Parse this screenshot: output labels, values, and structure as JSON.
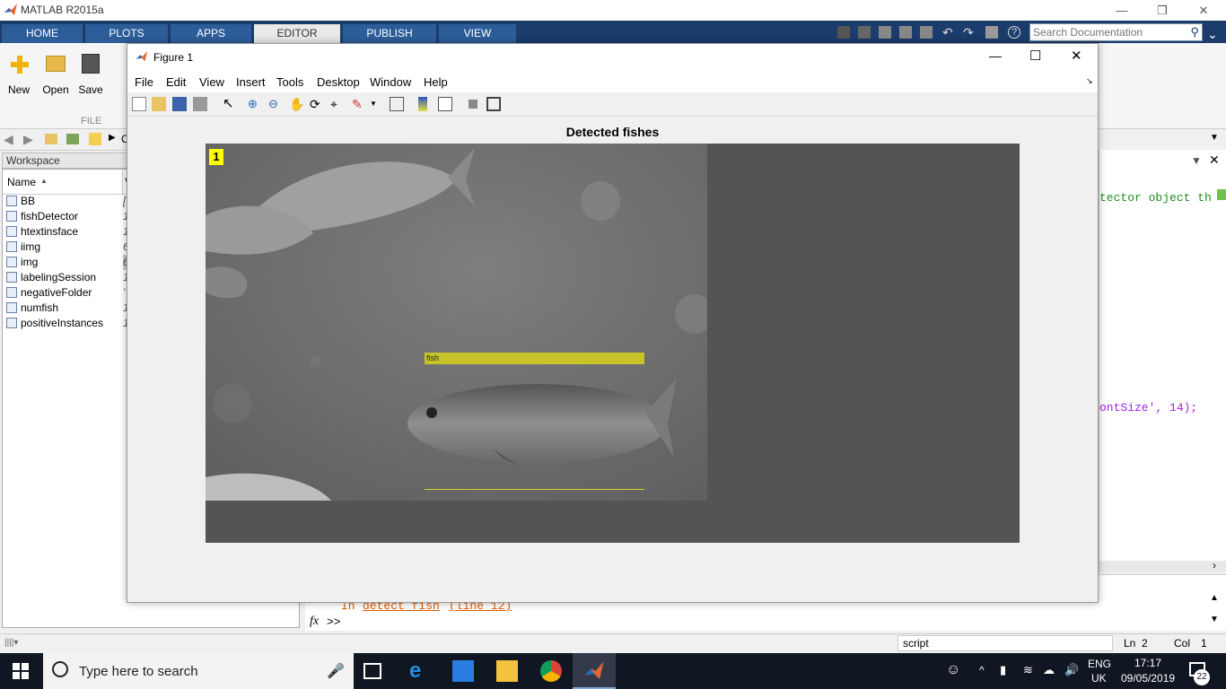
{
  "app": {
    "title": "MATLAB R2015a"
  },
  "ribbon": {
    "tabs": [
      "HOME",
      "PLOTS",
      "APPS",
      "EDITOR",
      "PUBLISH",
      "VIEW"
    ],
    "active_tab": "EDITOR",
    "search_placeholder": "Search Documentation",
    "file_buttons": {
      "new": "New",
      "open": "Open",
      "save": "Save"
    },
    "section_file": "FILE"
  },
  "address": {
    "partial": "C"
  },
  "workspace": {
    "title": "Workspace",
    "col_name": "Name",
    "col_value": "V",
    "rows": [
      {
        "name": "BB",
        "value": "["
      },
      {
        "name": "fishDetector",
        "value": "1"
      },
      {
        "name": "htextinsface",
        "value": "1"
      },
      {
        "name": "iimg",
        "value": "6"
      },
      {
        "name": "img",
        "value": "6"
      },
      {
        "name": "labelingSession",
        "value": "1"
      },
      {
        "name": "negativeFolder",
        "value": "'"
      },
      {
        "name": "numfish",
        "value": "1"
      },
      {
        "name": "positiveInstances",
        "value": "1"
      }
    ]
  },
  "editor": {
    "code_line1": "tector object th",
    "code_line2": "ontSize', 14);"
  },
  "command": {
    "error_prefix": "In",
    "error_func": "detect_fish",
    "error_line": "(line 12)",
    "prompt": ">>",
    "fx": "fx"
  },
  "status": {
    "mode": "script",
    "ln_label": "Ln",
    "ln": "2",
    "col_label": "Col",
    "col": "1"
  },
  "figure": {
    "title": "Figure 1",
    "menu": [
      "File",
      "Edit",
      "View",
      "Insert",
      "Tools",
      "Desktop",
      "Window",
      "Help"
    ],
    "axes_title": "Detected fishes",
    "bbox_label": "fish",
    "frame_number": "1"
  },
  "taskbar": {
    "search_placeholder": "Type here to search",
    "lang": "ENG",
    "region": "UK",
    "time": "17:17",
    "date": "09/05/2019",
    "notifications": "22"
  },
  "colors": {
    "ribbon_tab_bg": "#1b3c6c",
    "tab_bg": "#2d5d99",
    "bbox": "#c7c42a",
    "badge": "#ffff00"
  }
}
